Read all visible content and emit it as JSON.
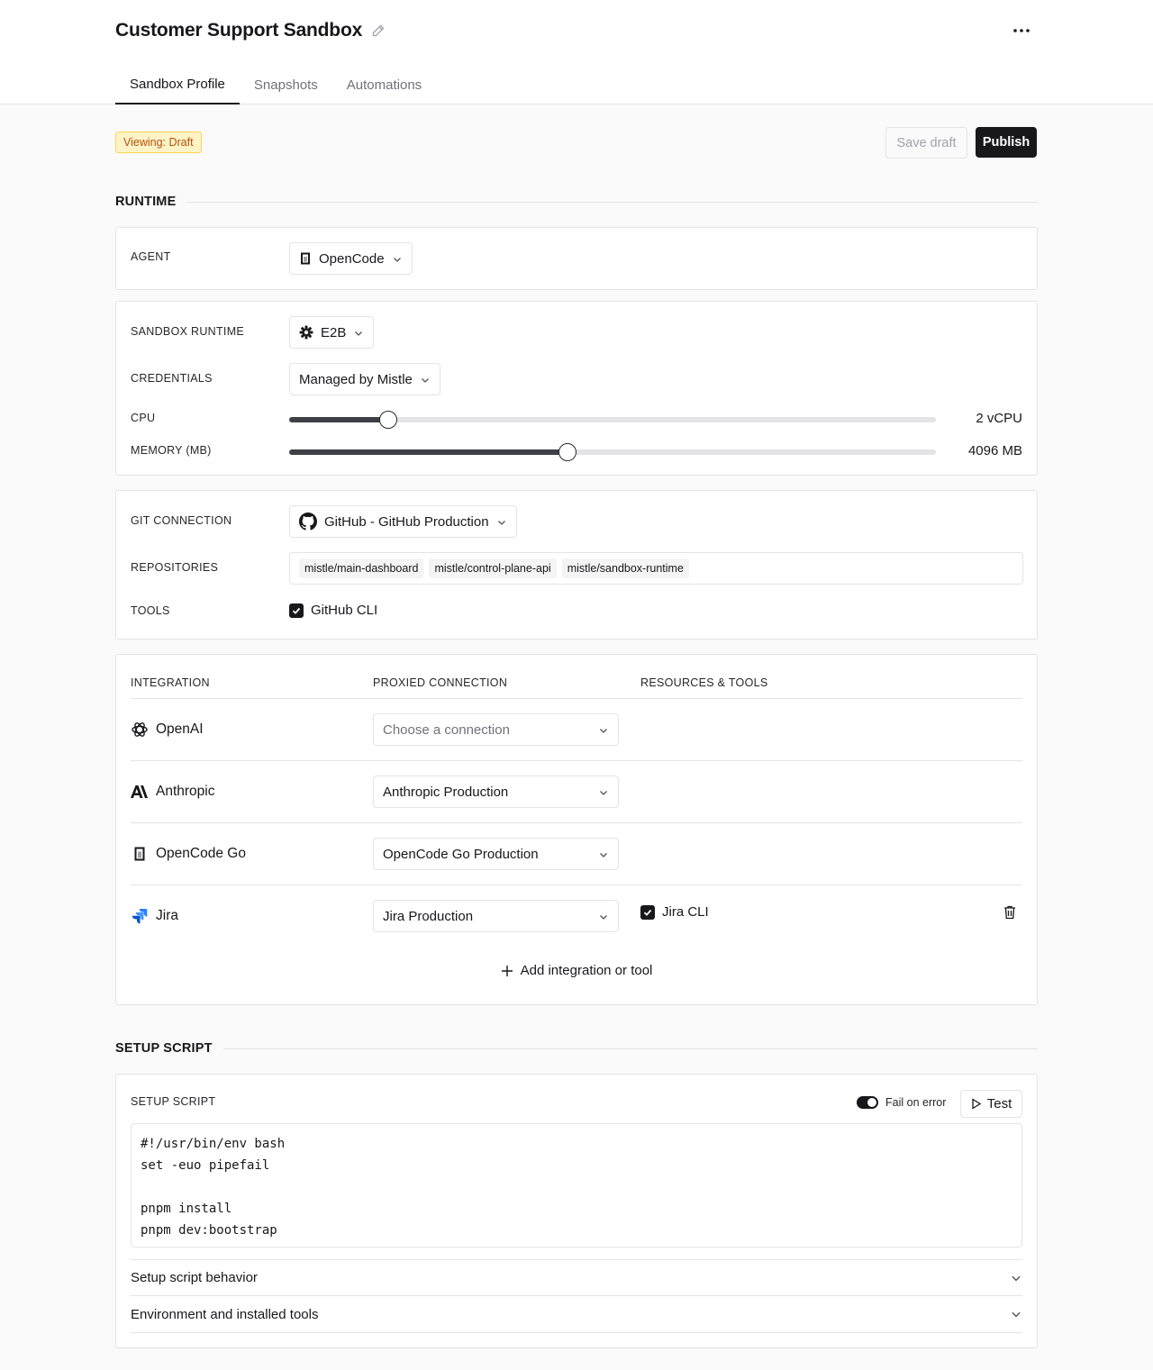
{
  "header": {
    "title": "Customer Support Sandbox",
    "tabs": [
      {
        "label": "Sandbox Profile",
        "active": true
      },
      {
        "label": "Snapshots",
        "active": false
      },
      {
        "label": "Automations",
        "active": false
      }
    ]
  },
  "toolbar": {
    "badge": "Viewing: Draft",
    "save_label": "Save draft",
    "publish_label": "Publish"
  },
  "runtime": {
    "section_title": "RUNTIME",
    "agent": {
      "label": "AGENT",
      "value": "OpenCode"
    },
    "sandbox_runtime": {
      "label": "SANDBOX RUNTIME",
      "value": "E2B"
    },
    "credentials": {
      "label": "CREDENTIALS",
      "value": "Managed by Mistle"
    },
    "cpu": {
      "label": "CPU",
      "value_text": "2 vCPU",
      "fraction": 0.153
    },
    "memory": {
      "label": "MEMORY (MB)",
      "value_text": "4096 MB",
      "fraction": 0.43
    },
    "git": {
      "label": "GIT CONNECTION",
      "value": "GitHub - GitHub Production",
      "repositories_label": "REPOSITORIES",
      "repositories": [
        "mistle/main-dashboard",
        "mistle/control-plane-api",
        "mistle/sandbox-runtime"
      ],
      "tools_label": "TOOLS",
      "tools": [
        {
          "label": "GitHub CLI",
          "checked": true
        }
      ]
    }
  },
  "integrations": {
    "headers": {
      "integration": "INTEGRATION",
      "connection": "PROXIED CONNECTION",
      "resources": "RESOURCES & TOOLS"
    },
    "rows": [
      {
        "name": "OpenAI",
        "icon": "openai-icon",
        "connection": "Choose a connection",
        "placeholder": true
      },
      {
        "name": "Anthropic",
        "icon": "anthropic-icon",
        "connection": "Anthropic Production",
        "placeholder": false
      },
      {
        "name": "OpenCode Go",
        "icon": "opencode-icon",
        "connection": "OpenCode Go Production",
        "placeholder": false
      },
      {
        "name": "Jira",
        "icon": "jira-icon",
        "connection": "Jira Production",
        "placeholder": false,
        "tool": "Jira CLI",
        "tool_checked": true
      }
    ],
    "add_label": "Add integration or tool"
  },
  "setup": {
    "section_title": "SETUP SCRIPT",
    "label": "SETUP SCRIPT",
    "fail_on_error_label": "Fail on error",
    "fail_on_error": true,
    "test_label": "Test",
    "script": "#!/usr/bin/env bash\nset -euo pipefail\n\npnpm install\npnpm dev:bootstrap",
    "accordions": [
      "Setup script behavior",
      "Environment and installed tools"
    ]
  }
}
